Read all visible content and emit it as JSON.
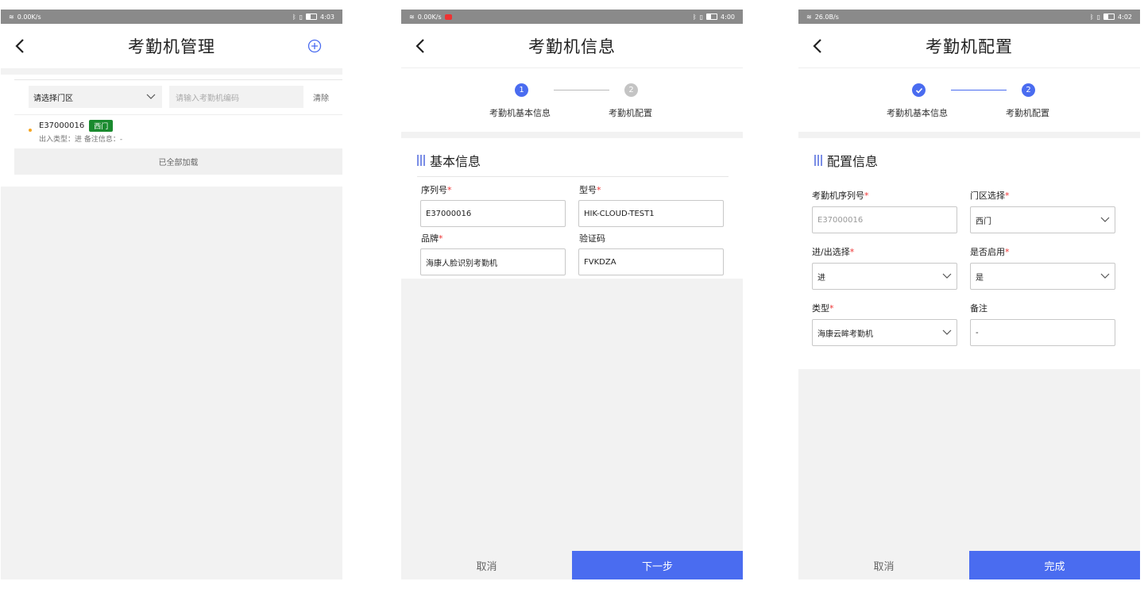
{
  "s1": {
    "status": {
      "speed": "0.00K/s",
      "time": "4:03"
    },
    "title": "考勤机管理",
    "filter": {
      "select_label": "请选择门区",
      "input_placeholder": "请输入考勤机编码",
      "clear_label": "清除"
    },
    "items": [
      {
        "code": "E37000016",
        "badge": "西门",
        "detail": "出入类型：进  备注信息：-"
      }
    ],
    "loaded_text": "已全部加载"
  },
  "s2": {
    "status": {
      "speed": "0.00K/s",
      "time": "4:00"
    },
    "title": "考勤机信息",
    "steps": [
      {
        "num": "1",
        "label": "考勤机基本信息"
      },
      {
        "num": "2",
        "label": "考勤机配置"
      }
    ],
    "section_title": "基本信息",
    "fields": {
      "serial": {
        "label": "序列号",
        "value": "E37000016"
      },
      "model": {
        "label": "型号",
        "value": "HIK-CLOUD-TEST1"
      },
      "brand": {
        "label": "品牌",
        "value": "海康人脸识别考勤机"
      },
      "code": {
        "label": "验证码",
        "value": "FVKDZA"
      }
    },
    "req_mark": "*",
    "cancel_label": "取消",
    "next_label": "下一步"
  },
  "s3": {
    "status": {
      "speed": "26.0B/s",
      "time": "4:02"
    },
    "title": "考勤机配置",
    "steps": [
      {
        "label": "考勤机基本信息"
      },
      {
        "num": "2",
        "label": "考勤机配置"
      }
    ],
    "section_title": "配置信息",
    "fields": {
      "serial": {
        "label": "考勤机序列号",
        "value": "E37000016"
      },
      "area": {
        "label": "门区选择",
        "value": "西门"
      },
      "inout": {
        "label": "进/出选择",
        "value": "进"
      },
      "enabled": {
        "label": "是否启用",
        "value": "是"
      },
      "type": {
        "label": "类型",
        "value": "海康云眸考勤机"
      },
      "remark": {
        "label": "备注",
        "value": "-"
      }
    },
    "req_mark": "*",
    "cancel_label": "取消",
    "done_label": "完成"
  },
  "colors": {
    "primary": "#4a6cf0",
    "badge_green": "#1a8a2e",
    "required_red": "#e33333",
    "dot_orange": "#f5a623"
  }
}
